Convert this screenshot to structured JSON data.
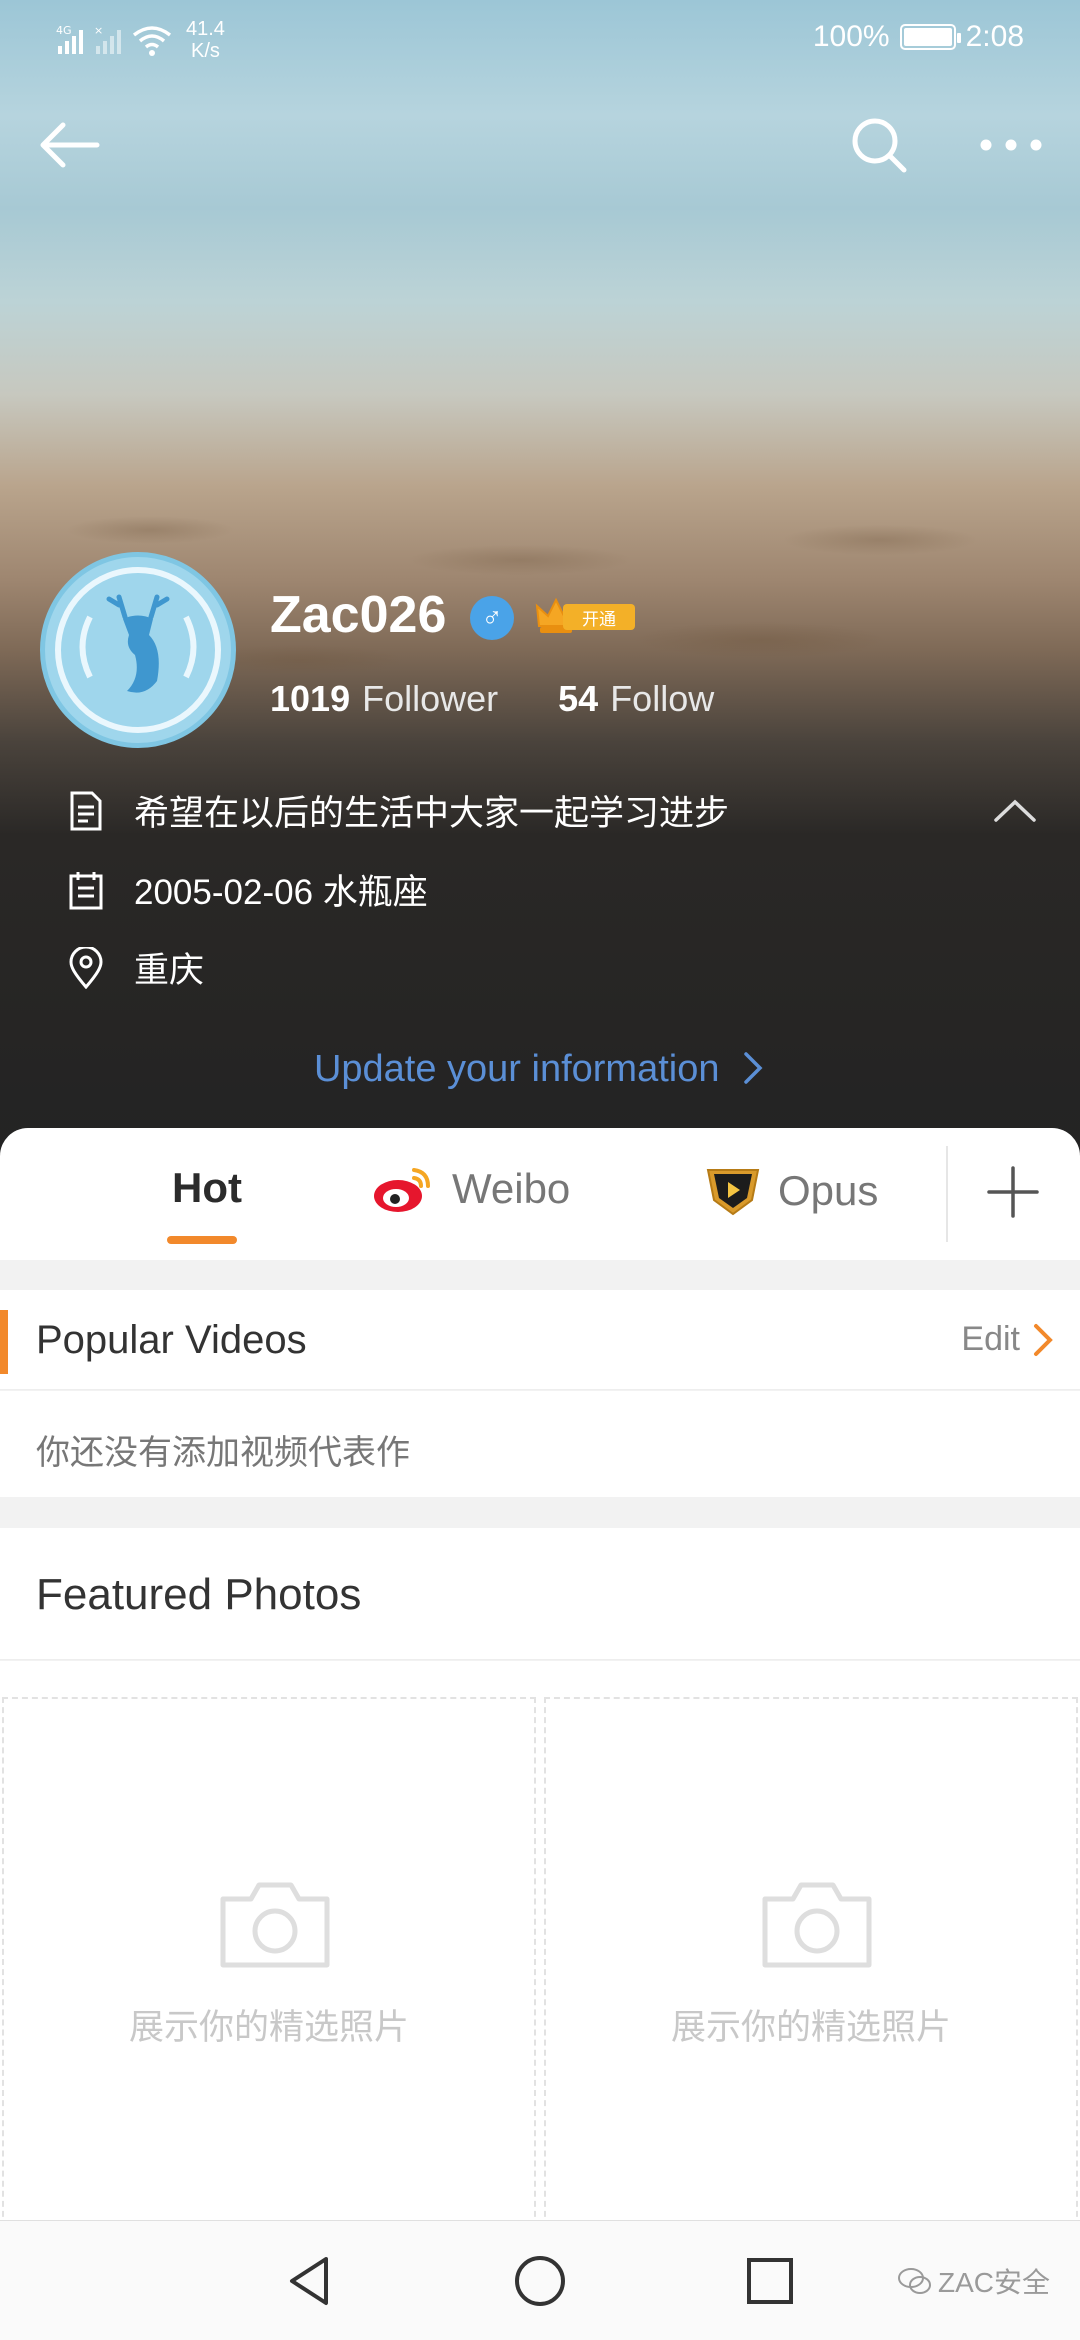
{
  "status_bar": {
    "network": "4G",
    "net_speed_value": "41.4",
    "net_speed_unit": "K/s",
    "battery_percent": "100%",
    "battery_level": 1.0,
    "time": "2:08"
  },
  "header": {
    "back_icon": "arrow-left-icon",
    "search_icon": "search-icon",
    "more_icon": "more-horizontal-icon"
  },
  "profile": {
    "username": "Zac026",
    "gender_symbol": "♂",
    "vip_label": "开通",
    "followers_count": "1019",
    "followers_label": "Follower",
    "following_count": "54",
    "following_label": "Follow",
    "bio": "希望在以后的生活中大家一起学习进步",
    "birthday": "2005-02-06 水瓶座",
    "location": "重庆",
    "update_link": "Update your information"
  },
  "tabs": [
    {
      "label": "Hot",
      "icon": "",
      "active": true
    },
    {
      "label": "Weibo",
      "icon": "weibo-icon",
      "active": false
    },
    {
      "label": "Opus",
      "icon": "opus-icon",
      "active": false
    }
  ],
  "popular_videos": {
    "title": "Popular Videos",
    "edit_label": "Edit",
    "empty_text": "你还没有添加视频代表作"
  },
  "featured_photos": {
    "title": "Featured Photos",
    "placeholder_text": "展示你的精选照片"
  },
  "watermark": "ZAC安全",
  "colors": {
    "accent_orange": "#f2892b",
    "link_blue": "#5b8fd6",
    "gender_blue": "#4aa3e8",
    "vip_gold": "#f3b028"
  }
}
